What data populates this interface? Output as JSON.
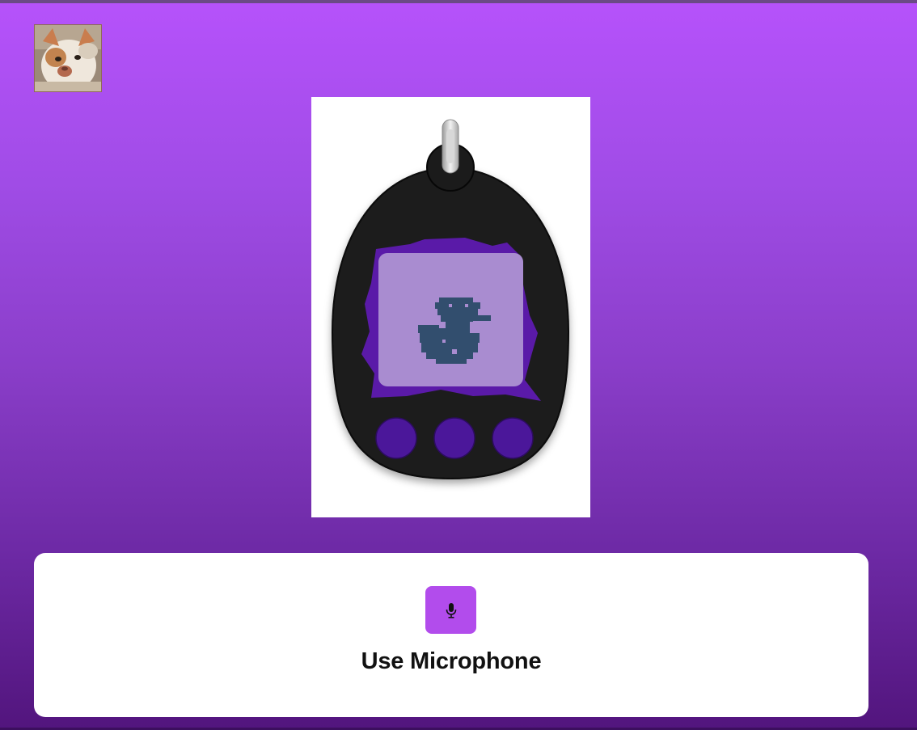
{
  "profile": {
    "avatar_icon": "cat-photo-avatar"
  },
  "device": {
    "icon": "tamagotchi-device",
    "pet_icon": "pixel-duck-pet-icon",
    "buttons": [
      "left",
      "middle",
      "right"
    ],
    "colors": {
      "shell": "#1b1b1b",
      "screen_bg": "#a98cd0",
      "crack": "#5a1aa8",
      "button": "#4b179a",
      "pet": "#324e6e"
    }
  },
  "mic": {
    "icon": "microphone-icon",
    "label": "Use Microphone",
    "accent": "#b24cec"
  },
  "background": {
    "gradient_top": "#b652fb",
    "gradient_bottom": "#52157d"
  }
}
